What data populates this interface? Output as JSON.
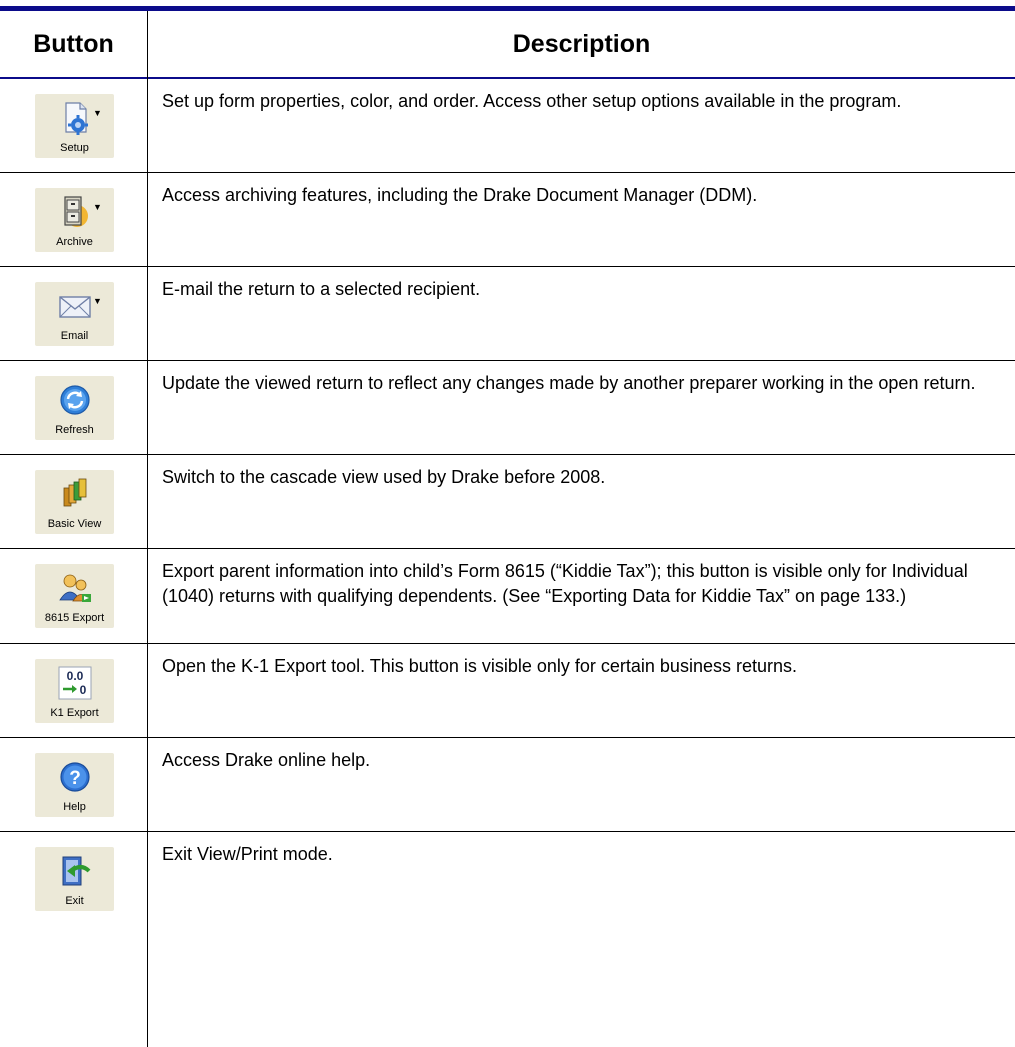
{
  "header": {
    "button_col": "Button",
    "description_col": "Description"
  },
  "rows": [
    {
      "caption": "Setup",
      "icon": "setup-icon",
      "dropdown": true,
      "description": "Set up form properties, color, and order. Access other setup options available in the program."
    },
    {
      "caption": "Archive",
      "icon": "archive-icon",
      "dropdown": true,
      "description": "Access archiving features, including the Drake Document Manager (DDM)."
    },
    {
      "caption": "Email",
      "icon": "email-icon",
      "dropdown": true,
      "description": "E-mail the return to a selected recipient."
    },
    {
      "caption": "Refresh",
      "icon": "refresh-icon",
      "dropdown": false,
      "description": "Update the viewed return to reflect any changes made by another preparer working in the open return."
    },
    {
      "caption": "Basic View",
      "icon": "basic-view-icon",
      "dropdown": false,
      "description": "Switch to the cascade view used by Drake before 2008."
    },
    {
      "caption": "8615 Export",
      "icon": "export-8615-icon",
      "dropdown": false,
      "description": "Export parent information into child’s Form 8615 (“Kiddie Tax”); this button is visible only for Individual (1040) returns with qualifying dependents. (See “Exporting Data for Kiddie Tax” on page 133.)"
    },
    {
      "caption": "K1 Export",
      "icon": "k1-export-icon",
      "dropdown": false,
      "icon_text": "0.0 → 0",
      "description": "Open the K-1 Export tool. This button is visible only for certain business returns."
    },
    {
      "caption": "Help",
      "icon": "help-icon",
      "dropdown": false,
      "description": "Access Drake online help."
    },
    {
      "caption": "Exit",
      "icon": "exit-icon",
      "dropdown": false,
      "description": "Exit View/Print mode."
    }
  ],
  "colors": {
    "rule": "#0b0b8a",
    "tile": "#ece9d8"
  }
}
